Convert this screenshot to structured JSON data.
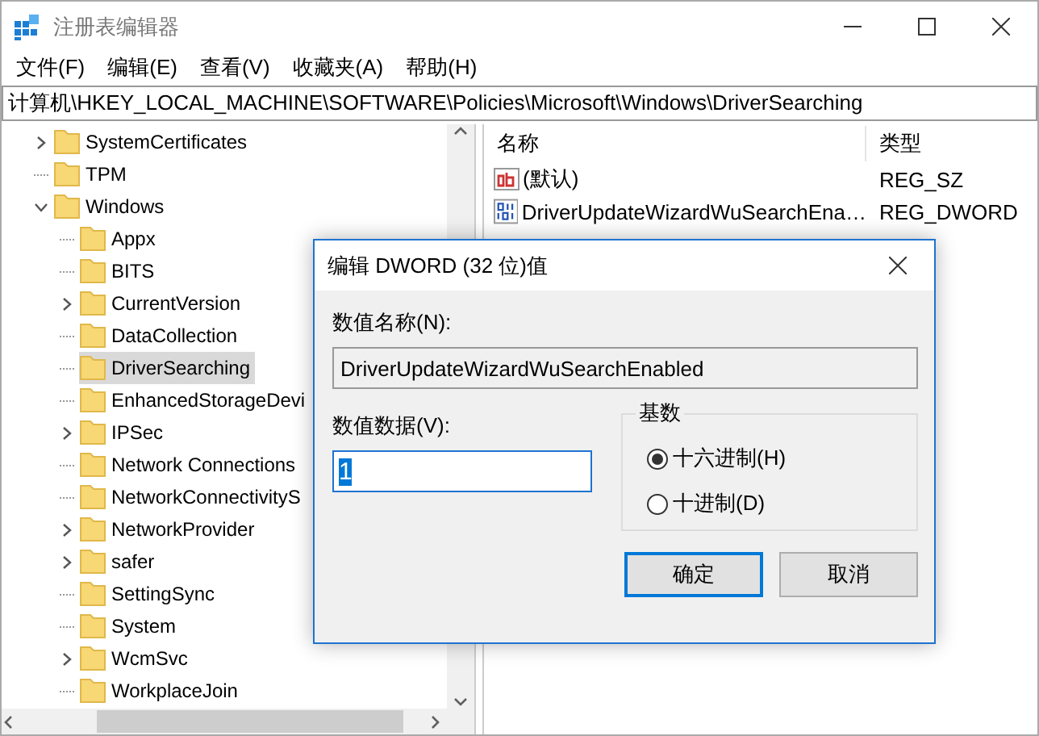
{
  "window": {
    "title": "注册表编辑器"
  },
  "menu": [
    "文件(F)",
    "编辑(E)",
    "查看(V)",
    "收藏夹(A)",
    "帮助(H)"
  ],
  "address": "计算机\\HKEY_LOCAL_MACHINE\\SOFTWARE\\Policies\\Microsoft\\Windows\\DriverSearching",
  "tree": [
    {
      "label": "SystemCertificates",
      "kind": "branch",
      "expanded": false,
      "selected": false
    },
    {
      "label": "TPM",
      "kind": "leaf",
      "selected": false
    },
    {
      "label": "Windows",
      "kind": "branch",
      "expanded": true,
      "selected": false,
      "children": [
        {
          "label": "Appx",
          "kind": "leaf",
          "selected": false
        },
        {
          "label": "BITS",
          "kind": "leaf",
          "selected": false
        },
        {
          "label": "CurrentVersion",
          "kind": "branch",
          "expanded": false,
          "selected": false
        },
        {
          "label": "DataCollection",
          "kind": "leaf",
          "selected": false
        },
        {
          "label": "DriverSearching",
          "kind": "leaf",
          "selected": true
        },
        {
          "label": "EnhancedStorageDevi",
          "kind": "leaf",
          "selected": false
        },
        {
          "label": "IPSec",
          "kind": "branch",
          "expanded": false,
          "selected": false
        },
        {
          "label": "Network Connections",
          "kind": "leaf",
          "selected": false
        },
        {
          "label": "NetworkConnectivityS",
          "kind": "leaf",
          "selected": false
        },
        {
          "label": "NetworkProvider",
          "kind": "branch",
          "expanded": false,
          "selected": false
        },
        {
          "label": "safer",
          "kind": "branch",
          "expanded": false,
          "selected": false
        },
        {
          "label": "SettingSync",
          "kind": "leaf",
          "selected": false
        },
        {
          "label": "System",
          "kind": "leaf",
          "selected": false
        },
        {
          "label": "WcmSvc",
          "kind": "branch",
          "expanded": false,
          "selected": false
        },
        {
          "label": "WorkplaceJoin",
          "kind": "leaf",
          "selected": false
        }
      ]
    }
  ],
  "values": {
    "columns": [
      "名称",
      "类型"
    ],
    "rows": [
      {
        "kind": "string",
        "name": "(默认)",
        "type": "REG_SZ"
      },
      {
        "kind": "dword",
        "name": "DriverUpdateWizardWuSearchEna…",
        "type": "REG_DWORD"
      }
    ]
  },
  "dialog": {
    "title": "编辑 DWORD (32 位)值",
    "name_label": "数值名称(N):",
    "name_value": "DriverUpdateWizardWuSearchEnabled",
    "data_label": "数值数据(V):",
    "data_value": "1",
    "data_value_selected": true,
    "base_label": "基数",
    "bases": [
      {
        "label": "十六进制(H)",
        "selected": true
      },
      {
        "label": "十进制(D)",
        "selected": false
      }
    ],
    "buttons": [
      {
        "label": "确定",
        "default": true
      },
      {
        "label": "取消",
        "default": false
      }
    ]
  }
}
